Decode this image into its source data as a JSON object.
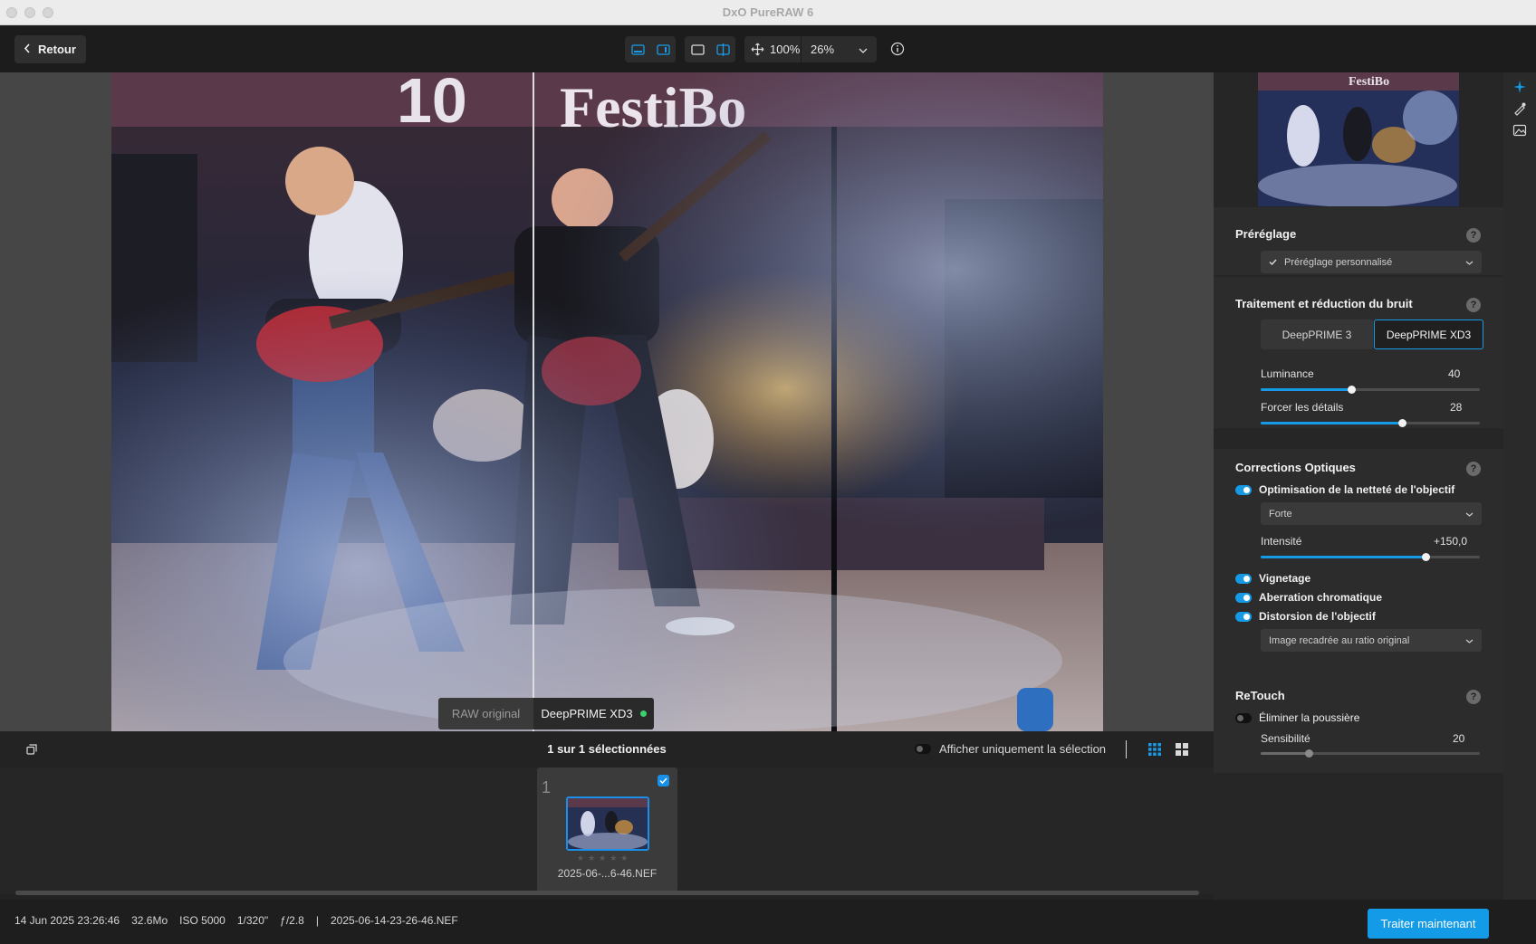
{
  "window": {
    "title": "DxO PureRAW 6"
  },
  "toolbar": {
    "back_label": "Retour",
    "zoom_fit_label": "100%",
    "zoom_value": "26%"
  },
  "compare": {
    "left_label": "RAW original",
    "right_label": "DeepPRIME XD3"
  },
  "filmstrip": {
    "selection_count": "1 sur 1 sélectionnées",
    "show_selection_label": "Afficher uniquement la sélection",
    "thumb_index": "1",
    "thumb_stars": "★★★★★",
    "thumb_filename": "2025-06-...6-46.NEF"
  },
  "status": {
    "date": "14 Jun 2025 23:26:46",
    "size": "32.6Mo",
    "iso": "ISO 5000",
    "shutter": "1/320\"",
    "aperture": "ƒ/2.8",
    "separator": "|",
    "filename": "2025-06-14-23-26-46.NEF",
    "process_button": "Traiter maintenant"
  },
  "panel": {
    "preset": {
      "title": "Préréglage",
      "help": "?",
      "value": "Préréglage personnalisé"
    },
    "denoise": {
      "title": "Traitement et réduction du bruit",
      "help": "?",
      "option_a": "DeepPRIME 3",
      "option_b": "DeepPRIME XD3",
      "luminance_label": "Luminance",
      "luminance_value": "40",
      "details_label": "Forcer les détails",
      "details_value": "28"
    },
    "optics": {
      "title": "Corrections Optiques",
      "help": "?",
      "sharpness_label": "Optimisation de la netteté de l'objectif",
      "sharpness_mode": "Forte",
      "intensity_label": "Intensité",
      "intensity_value": "+150,0",
      "vignetting_label": "Vignetage",
      "chromatic_label": "Aberration chromatique",
      "distortion_label": "Distorsion de l'objectif",
      "distortion_mode": "Image recadrée au ratio original"
    },
    "retouch": {
      "title": "ReTouch",
      "help": "?",
      "dust_label": "Éliminer la poussière",
      "sensitivity_label": "Sensibilité",
      "sensitivity_value": "20"
    }
  },
  "colors": {
    "accent": "#179ae6",
    "background": "#232323",
    "panel": "#2c2c2c"
  }
}
